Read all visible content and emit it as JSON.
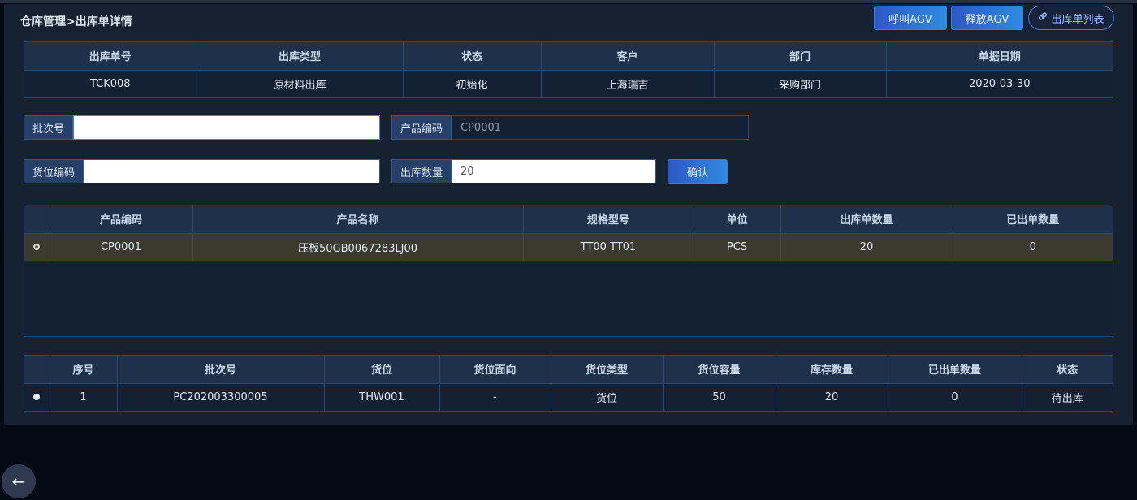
{
  "breadcrumb": "仓库管理>出库单详情",
  "header_buttons": {
    "call_agv": "呼叫AGV",
    "release_agv": "释放AGV",
    "list_icon": "link-icon",
    "order_list": "出库单列表"
  },
  "order_table": {
    "headers": [
      "出库单号",
      "出库类型",
      "状态",
      "客户",
      "部门",
      "单据日期"
    ],
    "row": [
      "TCK008",
      "原材料出库",
      "初始化",
      "上海瑞吉",
      "采购部门",
      "2020-03-30"
    ]
  },
  "form": {
    "batch_label": "批次号",
    "batch_value": "",
    "product_code_label": "产品编码",
    "product_code_value": "CP0001",
    "location_label": "货位编码",
    "location_value": "",
    "quantity_label": "出库数量",
    "quantity_value": "20",
    "confirm_label": "确认"
  },
  "product_table": {
    "headers": [
      "",
      "产品编码",
      "产品名称",
      "规格型号",
      "单位",
      "出库单数量",
      "已出单数量"
    ],
    "rows": [
      [
        "",
        "CP0001",
        "压板50GB0067283LJ00",
        "TT00 TT01",
        "PCS",
        "20",
        "0"
      ]
    ]
  },
  "stock_table": {
    "headers": [
      "",
      "序号",
      "批次号",
      "货位",
      "货位面向",
      "货位类型",
      "货位容量",
      "库存数量",
      "已出单数量",
      "状态"
    ],
    "rows": [
      [
        "",
        "1",
        "PC202003300005",
        "THW001",
        "-",
        "货位",
        "50",
        "20",
        "0",
        "待出库"
      ]
    ]
  },
  "back_icon": "arrow-left-icon"
}
